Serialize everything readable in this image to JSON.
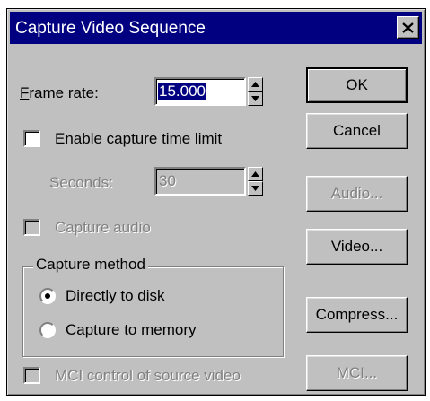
{
  "window": {
    "title": "Capture Video Sequence"
  },
  "frame_rate": {
    "label": "Frame rate:",
    "value": "15.000"
  },
  "time_limit": {
    "label": "Enable capture time limit",
    "checked": false
  },
  "seconds": {
    "label": "Seconds:",
    "value": "30"
  },
  "capture_audio": {
    "label": "Capture audio",
    "checked": false
  },
  "capture_method": {
    "title": "Capture method",
    "options": [
      {
        "label": "Directly to disk",
        "selected": true
      },
      {
        "label": "Capture to memory",
        "selected": false
      }
    ]
  },
  "mci_control": {
    "label": "MCI control of source video",
    "checked": false
  },
  "buttons": {
    "ok": "OK",
    "cancel": "Cancel",
    "audio": "Audio...",
    "video": "Video...",
    "compress": "Compress...",
    "mci": "MCI..."
  },
  "colors": {
    "titlebar": "#000080",
    "face": "#c0c0c0",
    "selection": "#000080"
  }
}
